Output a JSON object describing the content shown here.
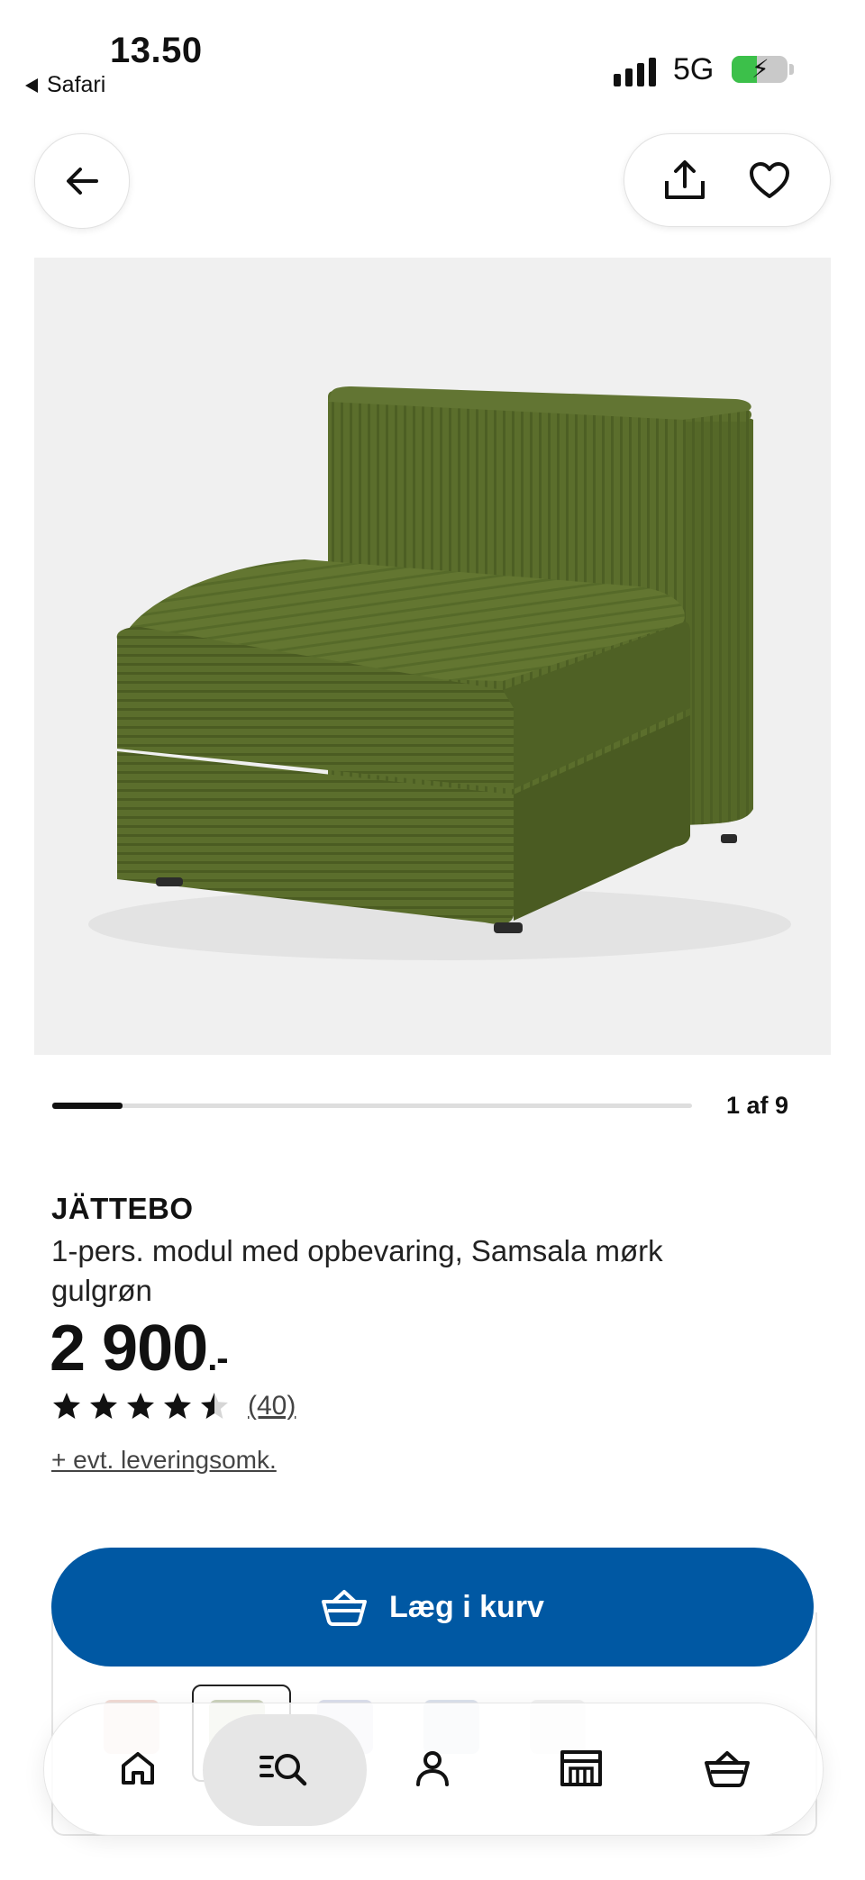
{
  "status_bar": {
    "time": "13.50",
    "back_app": "Safari",
    "network": "5G"
  },
  "product": {
    "name": "JÄTTEBO",
    "description": "1-pers. modul med opbevaring, Samsala mørk gulgrøn",
    "price": "2 900",
    "price_suffix": ".-",
    "rating": 4.5,
    "rating_max": 5,
    "review_count": "(40)",
    "delivery_link": "+ evt. leveringsomk.",
    "image_alt": "JÄTTEBO 1-pers. modul med opbevaring, Samsala mørk gulgrøn",
    "colors": {
      "fabric": "#5b6e2c",
      "fabric_dark": "#4a5b22",
      "fabric_light": "#6c7f37"
    }
  },
  "carousel": {
    "count": "1 af 9",
    "current": 1,
    "total": 9
  },
  "actions": {
    "add_to_cart": "Læg i kurv"
  },
  "tab_bar": {
    "items": [
      {
        "name": "home",
        "icon": "home-icon"
      },
      {
        "name": "search",
        "icon": "search-icon",
        "active": true
      },
      {
        "name": "profile",
        "icon": "person-icon"
      },
      {
        "name": "store",
        "icon": "store-icon"
      },
      {
        "name": "cart",
        "icon": "basket-icon"
      }
    ]
  },
  "theme": {
    "accent": "#0058a3",
    "text": "#111111",
    "muted": "#444444"
  }
}
